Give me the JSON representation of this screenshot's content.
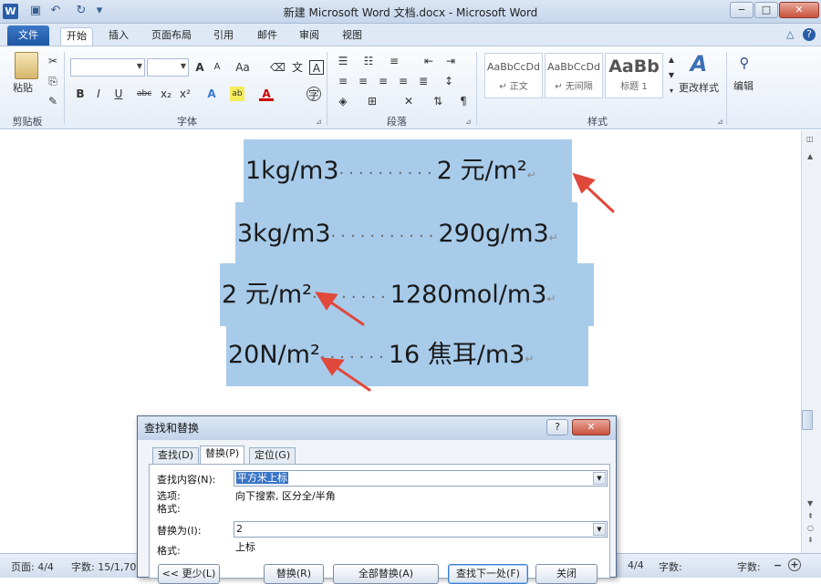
{
  "app": {
    "icon_letter": "W",
    "title": "新建 Microsoft Word 文档.docx - Microsoft Word",
    "window_buttons": [
      "−",
      "□",
      "✕"
    ]
  },
  "qat": {
    "save": "▣",
    "undo": "↶",
    "redo": "↻",
    "customize": "▾"
  },
  "tabs": {
    "file": "文件",
    "items": [
      "开始",
      "插入",
      "页面布局",
      "引用",
      "邮件",
      "审阅",
      "视图"
    ],
    "active": "开始",
    "help_controls": [
      "△",
      "?"
    ]
  },
  "ribbon": {
    "clipboard": {
      "paste": "粘贴",
      "group": "剪贴板"
    },
    "font": {
      "font_name": "",
      "font_size": "",
      "group": "字体",
      "buttons": [
        "B",
        "I",
        "U",
        "abc",
        "x₂",
        "x²",
        "A",
        "ab",
        "A",
        "字"
      ]
    },
    "paragraph": {
      "group": "段落"
    },
    "styles": {
      "group": "样式",
      "items": [
        {
          "sample": "AaBbCcDd",
          "name": "↵ 正文"
        },
        {
          "sample": "AaBbCcDd",
          "name": "↵ 无间隔"
        },
        {
          "sample": "AaBb",
          "name": "标题 1"
        }
      ],
      "change_styles": "更改样式"
    },
    "editing": {
      "label": "编辑"
    }
  },
  "document": {
    "lines": [
      {
        "left": "1kg/m3",
        "right": "2 元/m²"
      },
      {
        "left": "3kg/m3",
        "right": "290g/m3"
      },
      {
        "left": "2 元/m²",
        "right": "1280mol/m3"
      },
      {
        "left": "20N/m²",
        "right": "16 焦耳/m3"
      }
    ]
  },
  "statusbar": {
    "page": "页面: 4/4",
    "words": "字数: 15/1,706",
    "right_page": "4/4",
    "right_words1": "字数:",
    "right_words2": "字数:"
  },
  "dialog": {
    "title": "查找和替换",
    "help": "?",
    "close": "✕",
    "tabs": [
      "查找(D)",
      "替换(P)",
      "定位(G)"
    ],
    "active_tab": "替换(P)",
    "find_label": "查找内容(N):",
    "find_value": "平方米上标",
    "options_label": "选项:",
    "options_value": "向下搜索, 区分全/半角",
    "format_label": "格式:",
    "replace_label": "替换为(I):",
    "replace_value": "2",
    "format2_label": "格式:",
    "format2_value": "上标",
    "buttons": {
      "less": "<< 更少(L)",
      "replace": "替换(R)",
      "replace_all": "全部替换(A)",
      "find_next": "查找下一处(F)",
      "close": "关闭"
    }
  },
  "colors": {
    "selection": "#a8cbea",
    "arrow": "#e0483a",
    "accent": "#2a5ea8"
  }
}
